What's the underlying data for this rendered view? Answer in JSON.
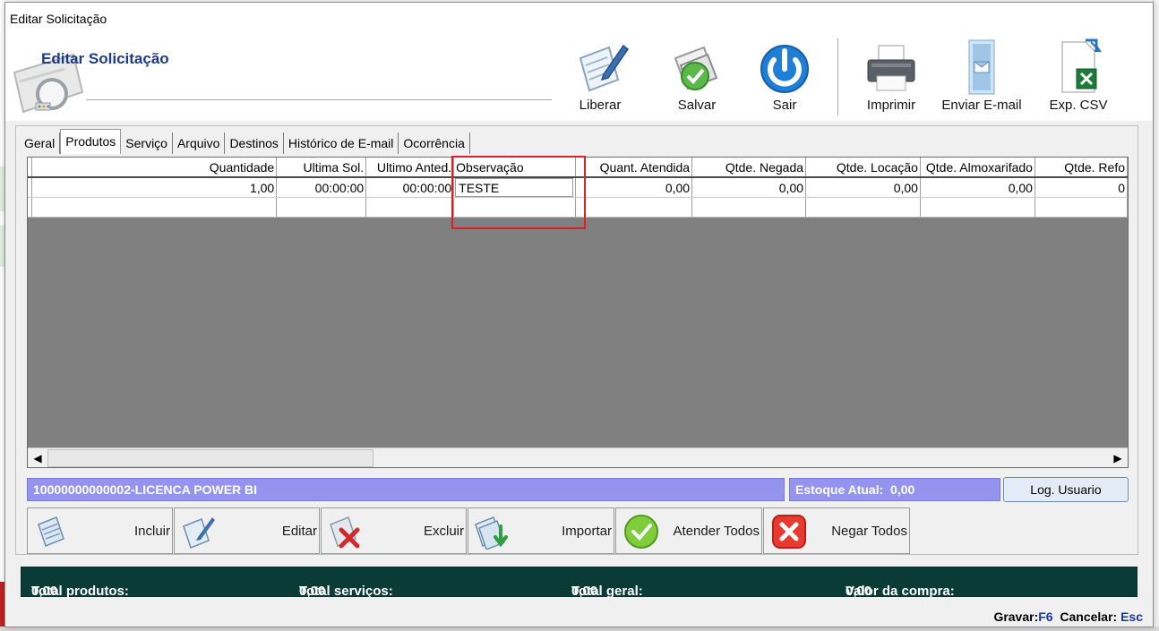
{
  "window": {
    "title": "Editar Solicitação"
  },
  "header": {
    "title": "Editar Solicitação",
    "toolbar": [
      {
        "key": "liberar",
        "label": "Liberar",
        "icon": "edit-document-icon"
      },
      {
        "key": "salvar",
        "label": "Salvar",
        "icon": "save-check-icon"
      },
      {
        "key": "sair",
        "label": "Sair",
        "icon": "power-icon"
      },
      {
        "key": "imprimir",
        "label": "Imprimir",
        "icon": "printer-icon"
      },
      {
        "key": "email",
        "label": "Enviar E-mail",
        "icon": "email-icon"
      },
      {
        "key": "csv",
        "label": "Exp. CSV",
        "icon": "excel-export-icon"
      }
    ]
  },
  "tabs": [
    "Geral",
    "Produtos",
    "Serviço",
    "Arquivo",
    "Destinos",
    "Histórico de E-mail",
    "Ocorrência"
  ],
  "active_tab": "Produtos",
  "grid": {
    "columns": [
      "Quantidade",
      "Ultima Sol.",
      "Ultimo Anted.",
      "Observação",
      "Quant. Atendida",
      "Qtde. Negada",
      "Qtde. Locação",
      "Qtde. Almoxarifado",
      "Qtde. Refo"
    ],
    "rows": [
      [
        "1,00",
        "00:00:00",
        "00:00:00",
        "TESTE",
        "0,00",
        "0,00",
        "0,00",
        "0,00",
        "0"
      ]
    ]
  },
  "status": {
    "product": "10000000000002-LICENCA POWER BI",
    "stock_label": "Estoque Atual:",
    "stock_value": "0,00",
    "log_button": "Log. Usuario"
  },
  "actions": [
    {
      "key": "incluir",
      "label": "Incluir",
      "icon": "document-add-icon"
    },
    {
      "key": "editar",
      "label": "Editar",
      "icon": "edit-icon"
    },
    {
      "key": "excluir",
      "label": "Excluir",
      "icon": "delete-icon"
    },
    {
      "key": "importar",
      "label": "Importar",
      "icon": "import-icon"
    },
    {
      "key": "atender",
      "label": "Atender Todos",
      "icon": "check-circle-icon"
    },
    {
      "key": "negar",
      "label": "Negar Todos",
      "icon": "close-square-icon"
    }
  ],
  "totals": {
    "produtos_label": "Total produtos:",
    "produtos_value": "0,00",
    "servicos_label": "Total serviços:",
    "servicos_value": "0,00",
    "geral_label": "Total geral:",
    "geral_value": "0,00",
    "compra_label": "Valor da compra:",
    "compra_value": "0,00"
  },
  "shortcuts": {
    "gravar_label": "Gravar:",
    "gravar_key": "F6",
    "cancelar_label": "Cancelar:",
    "cancelar_key": "Esc"
  },
  "colors": {
    "accent_text": "#1b3b8a",
    "status_bar": "#9494ef",
    "totals_bar": "#0b3b37",
    "highlight": "#e02020"
  }
}
